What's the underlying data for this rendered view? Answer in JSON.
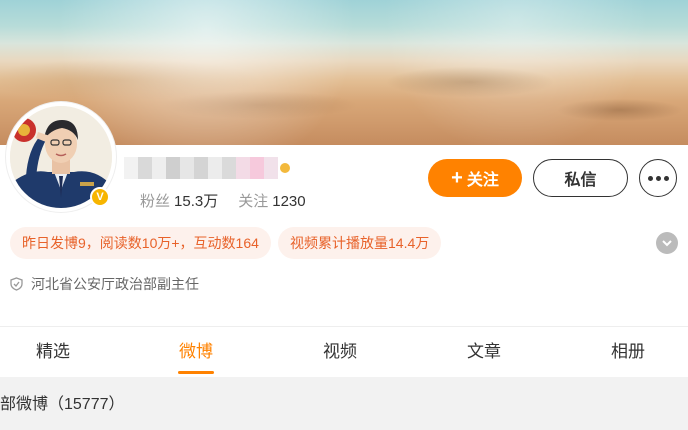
{
  "profile": {
    "fans_label": "粉丝",
    "fans_value": "15.3万",
    "following_label": "关注",
    "following_value": "1230",
    "verify_mark": "V"
  },
  "actions": {
    "follow_label": "关注",
    "follow_plus": "+",
    "message_label": "私信"
  },
  "tags": [
    {
      "label": "昨日发博9，阅读数10万+，互动数164"
    },
    {
      "label": "视频累计播放量14.4万"
    }
  ],
  "description": "河北省公安厅政治部副主任",
  "tabs": [
    {
      "label": "精选",
      "active": false
    },
    {
      "label": "微博",
      "active": true
    },
    {
      "label": "视频",
      "active": false
    },
    {
      "label": "文章",
      "active": false
    },
    {
      "label": "相册",
      "active": false
    }
  ],
  "all_posts_label": "部微博（15777）",
  "colors": {
    "accent": "#ff8200",
    "tag_bg": "#fdf1ec",
    "tag_text": "#e8622a",
    "verify": "#f7b500"
  },
  "icons": {
    "verify": "verified-badge-icon",
    "more": "more-dots-icon",
    "expand": "chevron-down-icon",
    "desc": "shield-icon"
  }
}
